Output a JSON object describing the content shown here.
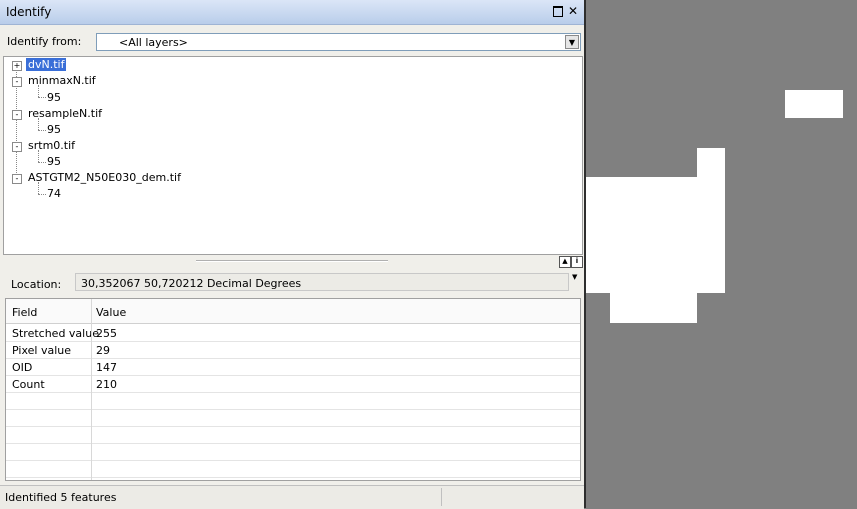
{
  "window": {
    "title": "Identify"
  },
  "identify_from": {
    "label": "Identify from:",
    "selected": "<All layers>"
  },
  "tree": {
    "layers": [
      {
        "name": "dvN.tif",
        "selected": true,
        "expander": "+"
      },
      {
        "name": "minmaxN.tif",
        "expander": "-",
        "value": "95"
      },
      {
        "name": "resampleN.tif",
        "expander": "-",
        "value": "95"
      },
      {
        "name": "srtm0.tif",
        "expander": "-",
        "value": "95"
      },
      {
        "name": "ASTGTM2_N50E030_dem.tif",
        "expander": "-",
        "value": "74"
      }
    ]
  },
  "location": {
    "label": "Location:",
    "value": "30,352067  50,720212 Decimal Degrees"
  },
  "table": {
    "headers": [
      "Field",
      "Value"
    ],
    "rows": [
      [
        "Stretched value",
        "255"
      ],
      [
        "Pixel value",
        "29"
      ],
      [
        "OID",
        "147"
      ],
      [
        "Count",
        "210"
      ]
    ]
  },
  "status": {
    "text": "Identified 5 features"
  },
  "colors": {
    "map_background": "#808080",
    "map_feature": "#ffffff",
    "selection": "#3a6fd8"
  },
  "icons": {
    "restore": "restore-icon",
    "close": "close-icon",
    "dropdown": "chevron-down-icon"
  }
}
